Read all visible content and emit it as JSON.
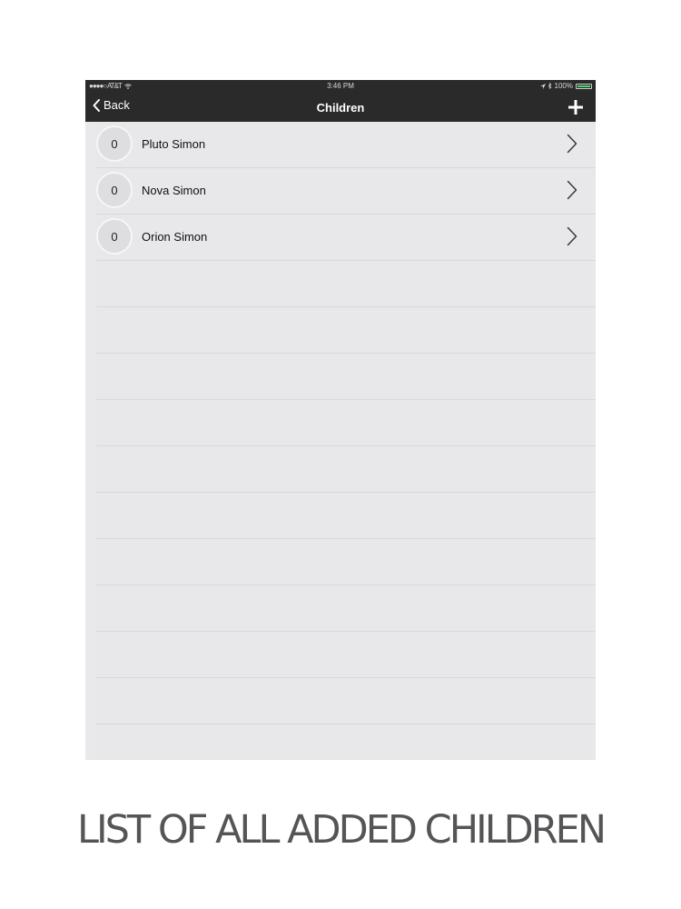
{
  "status_bar": {
    "carrier": "●●●●○ AT&T",
    "time": "3:46 PM",
    "battery": "100%"
  },
  "nav": {
    "back_label": "Back",
    "title": "Children",
    "add_icon": "plus-icon"
  },
  "children": [
    {
      "count": "0",
      "name": "Pluto Simon"
    },
    {
      "count": "0",
      "name": "Nova Simon"
    },
    {
      "count": "0",
      "name": "Orion Simon"
    }
  ],
  "caption": "LIST OF ALL ADDED CHILDREN",
  "colors": {
    "nav_background": "#2b2a2b",
    "list_background": "#e9e8ea",
    "battery_green": "#4cd964",
    "caption_text": "#555557"
  }
}
